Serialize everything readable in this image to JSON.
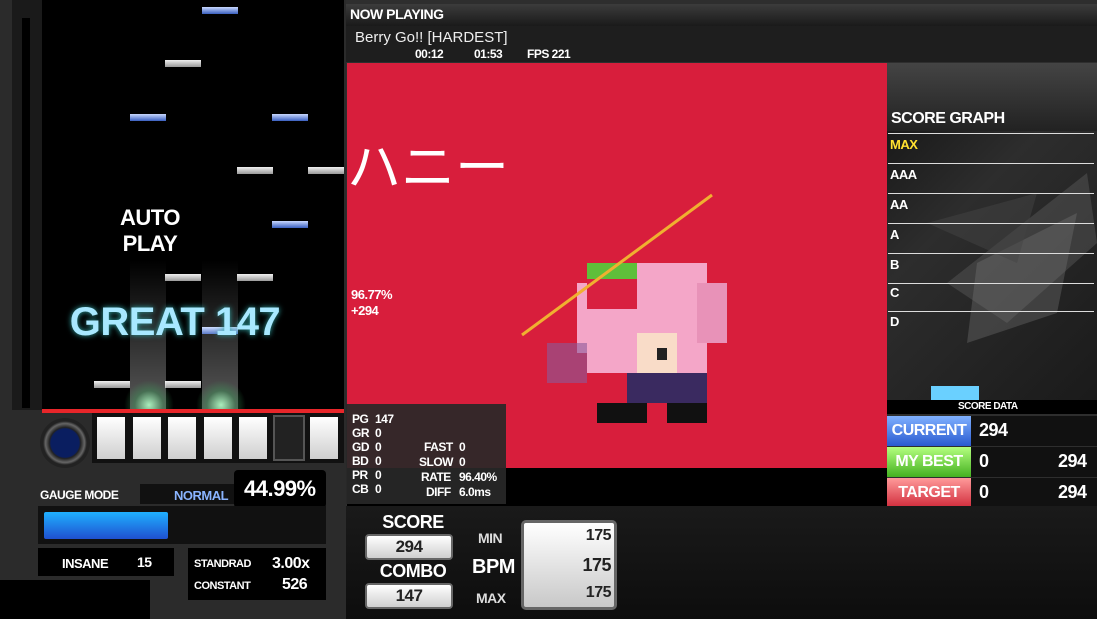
{
  "header": {
    "now_playing": "NOW PLAYING",
    "song_title": "Berry Go!! [HARDEST]",
    "time_now": "00:12",
    "time_total": "01:53",
    "fps": "FPS 221"
  },
  "playfield": {
    "auto_play": "AUTO PLAY",
    "judge": "GREAT 147",
    "overlay_rate": "96.77%",
    "overlay_diff": "+294"
  },
  "bga": {
    "text": "ハニー"
  },
  "judge_counts": {
    "pg_label": "PG",
    "pg": "147",
    "gr_label": "GR",
    "gr": "0",
    "gd_label": "GD",
    "gd": "0",
    "bd_label": "BD",
    "bd": "0",
    "pr_label": "PR",
    "pr": "0",
    "cb_label": "CB",
    "cb": "0",
    "fast_label": "FAST",
    "fast": "0",
    "slow_label": "SLOW",
    "slow": "0",
    "rate_label": "RATE",
    "rate": "96.40%",
    "diff_label": "DIFF",
    "diff": "6.0ms"
  },
  "gauge": {
    "mode_label": "GAUGE MODE",
    "type": "NORMAL",
    "percent": "44.99%",
    "fill_fraction": 0.4499,
    "color": "#1fb0ff"
  },
  "options": {
    "insane_label": "INSANE",
    "insane_value": "15",
    "hs_mode": "STANDRAD",
    "hs_value": "3.00x",
    "constant_label": "CONSTANT",
    "constant_value": "526"
  },
  "score_graph": {
    "title": "SCORE GRAPH",
    "grades": [
      "MAX",
      "AAA",
      "AA",
      "A",
      "B",
      "C",
      "D"
    ],
    "data_label": "SCORE DATA"
  },
  "score_data": {
    "current_label": "CURRENT",
    "current": "294",
    "mybest_label": "MY BEST",
    "mybest": "0",
    "mybest_target": "294",
    "target_label": "TARGET",
    "target": "0",
    "target_target": "294",
    "colors": {
      "current": "#2a5bd0",
      "mybest": "#44b020",
      "target": "#d02a3a"
    }
  },
  "bottom": {
    "score_label": "SCORE",
    "score": "294",
    "combo_label": "COMBO",
    "combo": "147",
    "min_label": "MIN",
    "bpm_label": "BPM",
    "max_label": "MAX",
    "bpm_min": "175",
    "bpm_now": "175",
    "bpm_max": "175"
  }
}
